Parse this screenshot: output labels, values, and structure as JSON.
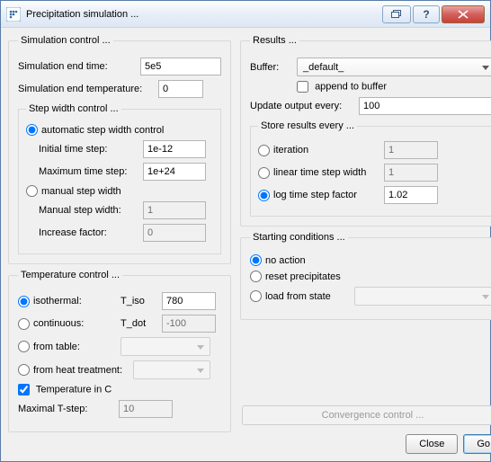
{
  "window": {
    "title": "Precipitation simulation ..."
  },
  "sim": {
    "legend": "Simulation control ...",
    "end_time_label": "Simulation end time:",
    "end_time_value": "5e5",
    "end_temp_label": "Simulation end temperature:",
    "end_temp_value": "0",
    "step_legend": "Step width control ...",
    "auto_label": "automatic step width  control",
    "init_step_label": "Initial time step:",
    "init_step_value": "1e-12",
    "max_step_label": "Maximum time step:",
    "max_step_value": "1e+24",
    "manual_label": "manual step width",
    "manual_width_label": "Manual step width:",
    "manual_width_value": "1",
    "inc_factor_label": "Increase factor:",
    "inc_factor_value": "0"
  },
  "temp": {
    "legend": "Temperature control ...",
    "isothermal_label": "isothermal:",
    "t_iso_label": "T_iso",
    "t_iso_value": "780",
    "continuous_label": "continuous:",
    "t_dot_label": "T_dot",
    "t_dot_value": "-100",
    "from_table_label": "from table:",
    "from_heat_label": "from heat treatment:",
    "temp_in_c_label": "Temperature in C",
    "max_tstep_label": "Maximal T-step:",
    "max_tstep_value": "10"
  },
  "results": {
    "legend": "Results ...",
    "buffer_label": "Buffer:",
    "buffer_value": "_default_",
    "append_label": "append to buffer",
    "update_label": "Update output every:",
    "update_value": "100",
    "store_legend": "Store results every ...",
    "iteration_label": "iteration",
    "iteration_value": "1",
    "linear_label": "linear time step width",
    "linear_value": "1",
    "log_label": "log time step factor",
    "log_value": "1.02"
  },
  "start": {
    "legend": "Starting conditions ...",
    "no_action_label": "no action",
    "reset_label": "reset precipitates",
    "load_label": "load from state"
  },
  "footer": {
    "convergence_label": "Convergence control ...",
    "close_label": "Close",
    "go_label": "Go"
  }
}
